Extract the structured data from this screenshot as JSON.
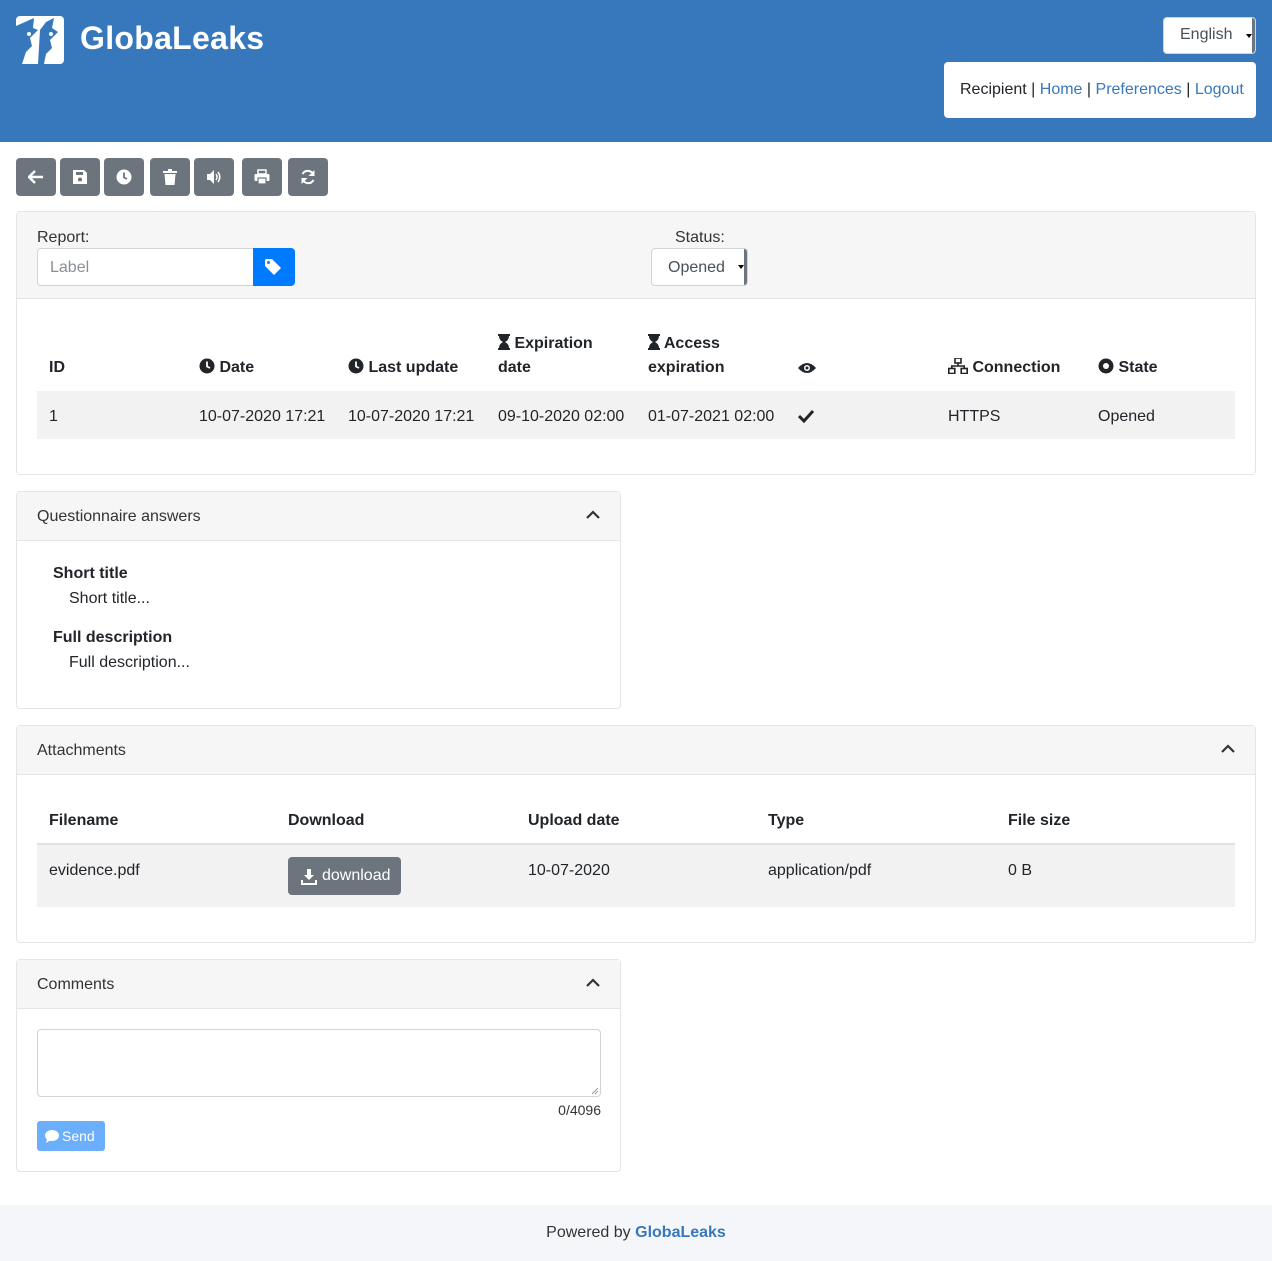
{
  "header": {
    "brand": "GlobaLeaks",
    "language": "English",
    "user_role": "Recipient",
    "sep": "|",
    "links": {
      "home": "Home",
      "preferences": "Preferences",
      "logout": "Logout"
    }
  },
  "toolbar": {
    "buttons": [
      "back-icon",
      "save-icon",
      "clock-icon",
      "trash-icon",
      "volume-icon",
      "print-icon",
      "refresh-icon"
    ]
  },
  "report": {
    "report_label": "Report:",
    "label_placeholder": "Label",
    "status_label": "Status:",
    "status_value": "Opened",
    "table": {
      "headers": {
        "id": "ID",
        "date": "Date",
        "last_update": "Last update",
        "expiration_line1": "Expiration",
        "expiration_line2": "date",
        "access_line1": "Access",
        "access_line2": "expiration",
        "connection": "Connection",
        "state": "State"
      },
      "row": {
        "id": "1",
        "date": "10-07-2020 17:21",
        "last_update": "10-07-2020 17:21",
        "expiration": "09-10-2020 02:00",
        "access_expiration": "01-07-2021 02:00",
        "connection": "HTTPS",
        "state": "Opened"
      }
    }
  },
  "questionnaire": {
    "title": "Questionnaire answers",
    "answers": [
      {
        "question": "Short title",
        "answer": "Short title..."
      },
      {
        "question": "Full description",
        "answer": "Full description..."
      }
    ]
  },
  "attachments": {
    "title": "Attachments",
    "headers": [
      "Filename",
      "Download",
      "Upload date",
      "Type",
      "File size"
    ],
    "rows": [
      {
        "filename": "evidence.pdf",
        "download_label": "download",
        "upload_date": "10-07-2020",
        "type": "application/pdf",
        "size": "0 B"
      }
    ]
  },
  "comments": {
    "title": "Comments",
    "counter": "0/4096",
    "send_label": "Send"
  },
  "footer": {
    "powered_by": "Powered by",
    "brand": "GlobaLeaks"
  },
  "colors": {
    "header_bg": "#3778bd",
    "toolbar_btn": "#6c757d",
    "primary": "#007bff",
    "send_btn": "#6aaefc"
  }
}
